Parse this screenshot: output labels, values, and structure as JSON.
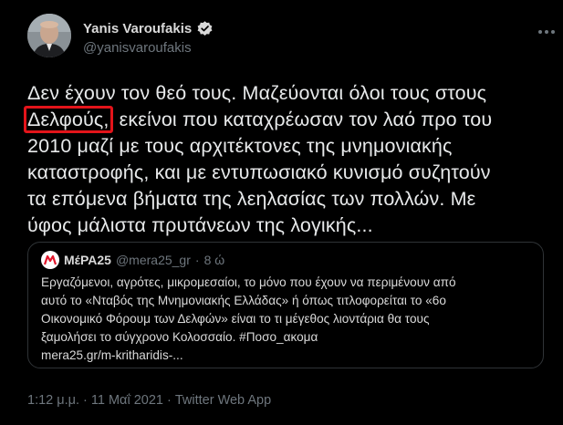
{
  "author": {
    "display_name": "Yanis Varoufakis",
    "handle": "@yanisvaroufakis",
    "verified": true,
    "avatar_icon": "profile-photo",
    "verified_icon": "verified-badge-icon"
  },
  "tweet": {
    "lines": [
      "Δεν έχουν τον θεό τους. Μαζεύονται όλοι τους στους",
      "εκείνοι που καταχρέωσαν τον λαό προ του",
      "2010 μαζί με τους αρχιτέκτονες της μνημονιακής",
      "καταστροφής, και με εντυπωσιακό κυνισμό συζητούν",
      "τα επόμενα βήματα της λεηλασίας των πολλών. Με",
      "ύφος μάλιστα πρυτάνεων της λογικής..."
    ],
    "highlighted_word": "Δελφούς,",
    "highlight_color": "#e3141a"
  },
  "quote": {
    "name": "ΜέΡΑ25",
    "handle": "@mera25_gr",
    "separator": "·",
    "time": "8 ώ",
    "lines": [
      "Εργαζόμενοι, αγρότες, μικρομεσαίοι, το μόνο που έχουν να περιμένουν από",
      "αυτό το «Νταβός της Μνημονιακής Ελλάδας» ή όπως τιτλοφορείται το «6ο",
      "Οικονομικό Φόρουμ των Δελφών» είναι το τι μέγεθος λιοντάρια θα τους",
      "ξαμολήσει το σύγχρονο Κολοσσαίο. #Ποσο_ακομα",
      "mera25.gr/m-kritharidis-..."
    ]
  },
  "footer": {
    "text": "1:12 μ.μ. · 11 Μαΐ 2021 · Twitter Web App"
  },
  "colors": {
    "background": "#000000",
    "text": "#e7e9ea",
    "secondary": "#6e767d",
    "border": "#2f3336",
    "link": "#1d9bf0"
  }
}
